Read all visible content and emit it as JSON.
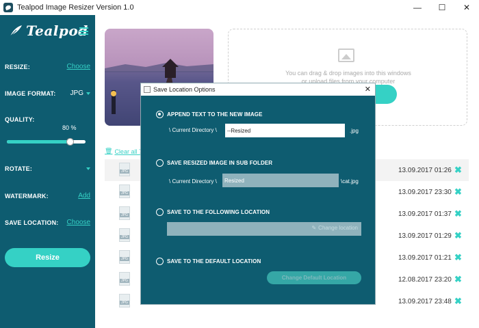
{
  "window": {
    "title": "Tealpod Image Resizer Version 1.0",
    "controls": {
      "minimize": "—",
      "maximize": "☐",
      "close": "✕"
    }
  },
  "sidebar": {
    "logo": "Tealpod",
    "resize": {
      "label": "RESIZE:",
      "action": "Choose"
    },
    "image_format": {
      "label": "IMAGE FORMAT:",
      "value": "JPG"
    },
    "quality": {
      "label": "QUALITY:",
      "value": "80 %",
      "level": 0.8
    },
    "rotate": {
      "label": "ROTATE:"
    },
    "watermark": {
      "label": "WATERMARK:",
      "action": "Add"
    },
    "save_location": {
      "label": "SAVE LOCATION:",
      "action": "Choose"
    },
    "resize_button": "Resize"
  },
  "main": {
    "drop_text_1": "You can drag & drop images into this windows",
    "drop_text_2": "or upload files from your computer",
    "clear_all": "Clear all 7 i",
    "files": [
      {
        "date": "13.09.2017 01:26"
      },
      {
        "date": "13.09.2017 23:30"
      },
      {
        "date": "13.09.2017 01:37"
      },
      {
        "date": "13.09.2017 01:29"
      },
      {
        "date": "13.09.2017 01:21"
      },
      {
        "date": "12.08.2017 23:20"
      },
      {
        "date": "13.09.2017 23:48"
      }
    ],
    "delete_symbol": "✖"
  },
  "modal": {
    "title": "Save Location Options",
    "close": "✕",
    "option1": {
      "label": "APPEND TEXT TO THE NEW IMAGE",
      "dir": "\\ Current Directory \\",
      "value": "--Resized",
      "ext": ".jpg"
    },
    "option2": {
      "label": "SAVE RESIZED IMAGE IN SUB FOLDER",
      "dir": "\\ Current Directory \\",
      "value": "Resized",
      "ext": "\\cat.jpg"
    },
    "option3": {
      "label": "SAVE TO THE FOLLOWING LOCATION",
      "button": "Change location"
    },
    "option4": {
      "label": "SAVE TO THE DEFAULT LOCATION",
      "button": "Change Default Location"
    }
  },
  "colors": {
    "sidebar": "#0e5c70",
    "accent": "#35d1c5"
  }
}
